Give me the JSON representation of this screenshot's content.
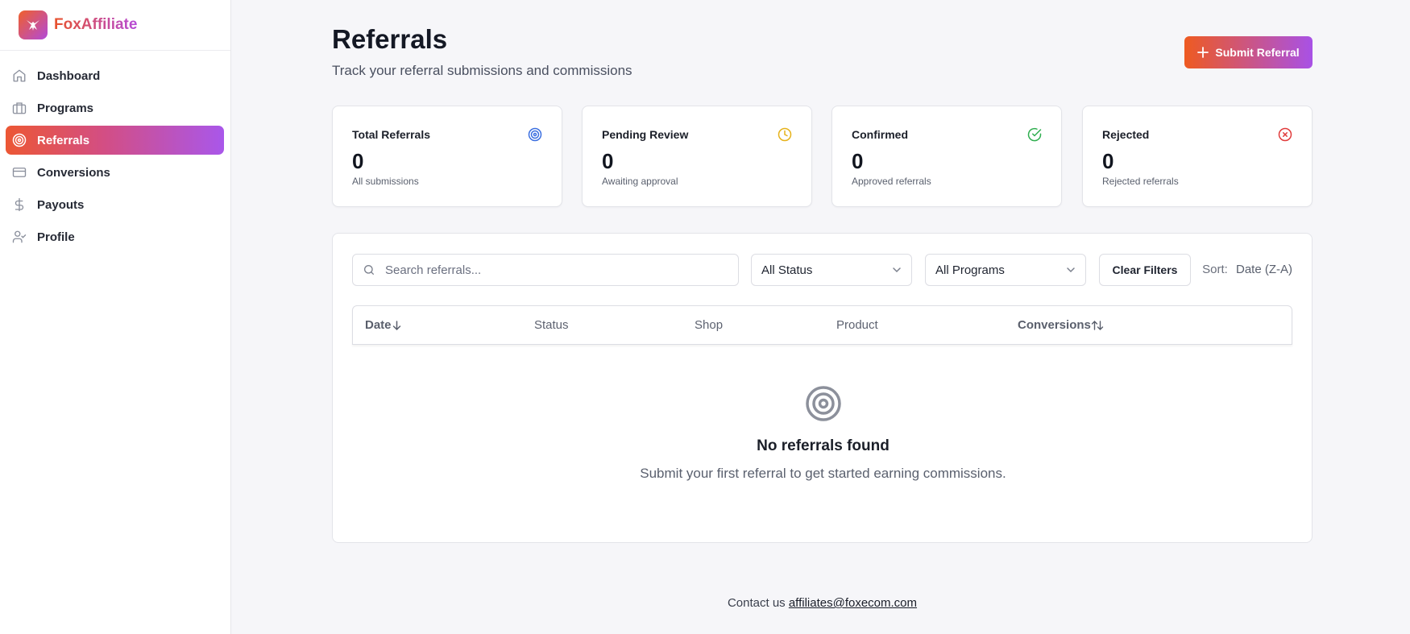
{
  "brand": {
    "name": "FoxAffiliate"
  },
  "sidebar": {
    "items": [
      {
        "label": "Dashboard",
        "icon": "home-icon"
      },
      {
        "label": "Programs",
        "icon": "briefcase-icon"
      },
      {
        "label": "Referrals",
        "icon": "target-icon",
        "active": true
      },
      {
        "label": "Conversions",
        "icon": "credit-card-icon"
      },
      {
        "label": "Payouts",
        "icon": "dollar-icon"
      },
      {
        "label": "Profile",
        "icon": "user-check-icon"
      }
    ]
  },
  "header": {
    "title": "Referrals",
    "subtitle": "Track your referral submissions and commissions",
    "submit_label": "Submit Referral"
  },
  "stats": [
    {
      "title": "Total Referrals",
      "value": "0",
      "caption": "All submissions",
      "icon": "target-icon",
      "color": "#3b6fe0"
    },
    {
      "title": "Pending Review",
      "value": "0",
      "caption": "Awaiting approval",
      "icon": "clock-icon",
      "color": "#e6b21a"
    },
    {
      "title": "Confirmed",
      "value": "0",
      "caption": "Approved referrals",
      "icon": "check-circle-icon",
      "color": "#2fae4f"
    },
    {
      "title": "Rejected",
      "value": "0",
      "caption": "Rejected referrals",
      "icon": "x-circle-icon",
      "color": "#e03b3b"
    }
  ],
  "filters": {
    "search_placeholder": "Search referrals...",
    "status_value": "All Status",
    "program_value": "All Programs",
    "clear_label": "Clear Filters",
    "sort_label": "Sort:",
    "sort_value": "Date (Z-A)"
  },
  "table": {
    "columns": [
      {
        "label": "Date",
        "sort_icon": "arrow-down-icon"
      },
      {
        "label": "Status"
      },
      {
        "label": "Shop"
      },
      {
        "label": "Product"
      },
      {
        "label": "Conversions",
        "sort_icon": "arrow-up-down-icon"
      }
    ]
  },
  "empty": {
    "title": "No referrals found",
    "text": "Submit your first referral to get started earning commissions."
  },
  "footer": {
    "text": "Contact us",
    "email": "affiliates@foxecom.com"
  },
  "colors": {
    "accent_start": "#ee5a21",
    "accent_end": "#a851e6"
  }
}
